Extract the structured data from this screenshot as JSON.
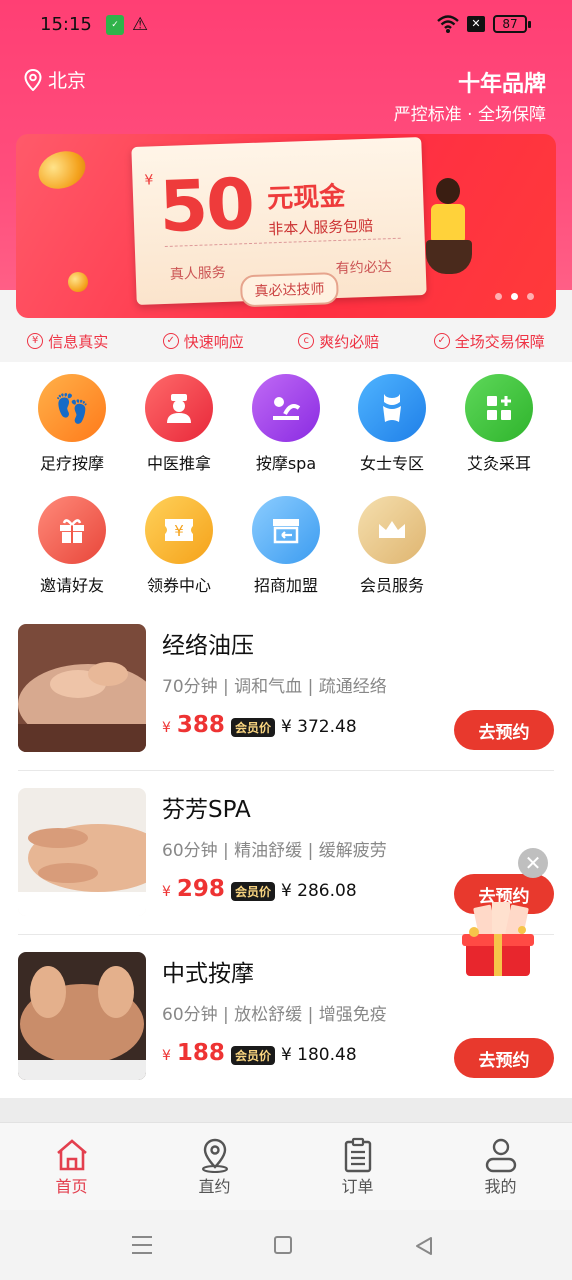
{
  "status_bar": {
    "time": "15:15",
    "battery": "87"
  },
  "header": {
    "location": "北京",
    "brand_title": "十年品牌",
    "brand_subtitle": "严控标准 · 全场保障"
  },
  "banner": {
    "yen": "¥",
    "amount": "50",
    "cash_label": "元现金",
    "guarantee": "非本人服务包赔",
    "left_tag": "真人服务",
    "right_tag": "有约必达",
    "pill": "真必达技师",
    "active_slide": 2,
    "total_slides": 3
  },
  "features": [
    {
      "icon": "yen-circle-icon",
      "label": "信息真实"
    },
    {
      "icon": "check-shield-icon",
      "label": "快速响应"
    },
    {
      "icon": "refund-circle-icon",
      "label": "爽约必赔"
    },
    {
      "icon": "check-shield-icon",
      "label": "全场交易保障"
    }
  ],
  "categories": [
    {
      "label": "足疗按摩",
      "icon": "footprint-icon",
      "color": "#ff8c1a"
    },
    {
      "label": "中医推拿",
      "icon": "doctor-icon",
      "color": "#f03a4a"
    },
    {
      "label": "按摩spa",
      "icon": "spa-massage-icon",
      "color": "#9b3df0"
    },
    {
      "label": "女士专区",
      "icon": "swimsuit-icon",
      "color": "#2f8ff0"
    },
    {
      "label": "艾灸采耳",
      "icon": "grid-plus-icon",
      "color": "#3dc43a"
    },
    {
      "label": "邀请好友",
      "icon": "gift-icon",
      "color": "#f25a4a"
    },
    {
      "label": "领券中心",
      "icon": "coupon-yen-icon",
      "color": "#f7b52a"
    },
    {
      "label": "招商加盟",
      "icon": "store-icon",
      "color": "#52aef5"
    },
    {
      "label": "会员服务",
      "icon": "crown-icon",
      "color": "#e9c888"
    }
  ],
  "services": [
    {
      "name": "经络油压",
      "desc": "70分钟 | 调和气血 | 疏通经络",
      "price": "388",
      "vip_tag": "会员价",
      "vip_price": "¥ 372.48",
      "button": "去预约"
    },
    {
      "name": "芬芳SPA",
      "desc": "60分钟 | 精油舒缓 | 缓解疲劳",
      "price": "298",
      "vip_tag": "会员价",
      "vip_price": "¥ 286.08",
      "button": "去预约"
    },
    {
      "name": "中式按摩",
      "desc": "60分钟 | 放松舒缓 | 增强免疫",
      "price": "188",
      "vip_tag": "会员价",
      "vip_price": "¥ 180.48",
      "button": "去预约"
    }
  ],
  "currency": "¥",
  "tabs": [
    {
      "label": "首页",
      "icon": "home-icon",
      "active": true
    },
    {
      "label": "直约",
      "icon": "location-pin-icon",
      "active": false
    },
    {
      "label": "订单",
      "icon": "clipboard-icon",
      "active": false
    },
    {
      "label": "我的",
      "icon": "user-icon",
      "active": false
    }
  ],
  "colors": {
    "brand": "#ff4477",
    "accent_red": "#e8392d",
    "active_tab": "#e33f4e"
  }
}
